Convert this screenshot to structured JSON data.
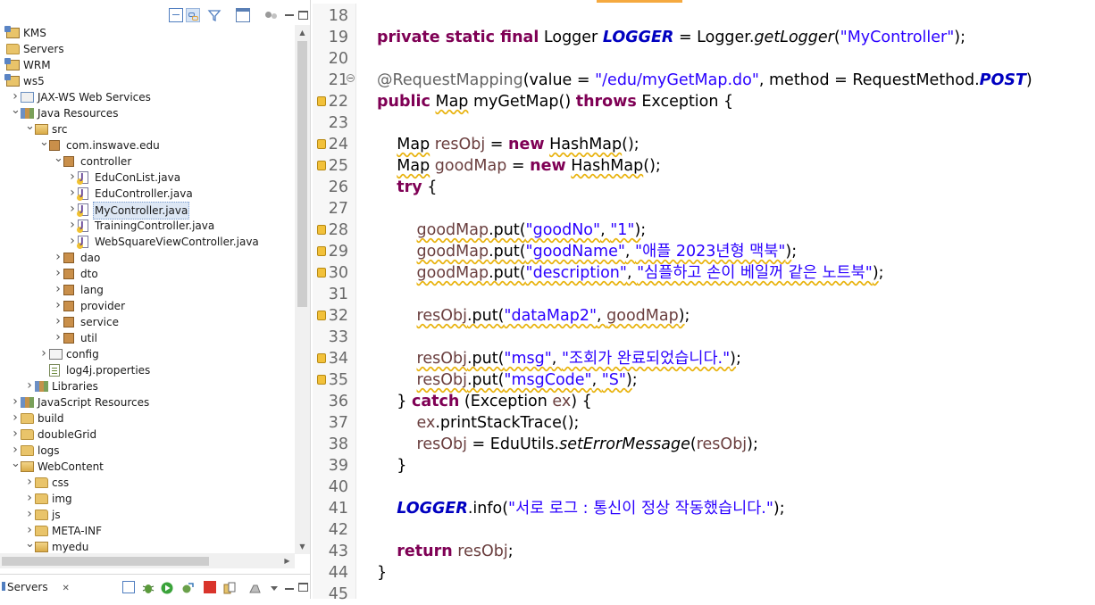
{
  "explorer": {
    "tree": [
      {
        "label": "KMS",
        "icon": "project-icon",
        "depth": 0,
        "twisty": ""
      },
      {
        "label": "Servers",
        "icon": "folder-icon",
        "depth": 0,
        "twisty": ""
      },
      {
        "label": "WRM",
        "icon": "project-icon",
        "depth": 0,
        "twisty": ""
      },
      {
        "label": "ws5",
        "icon": "project-icon",
        "depth": 0,
        "twisty": ""
      },
      {
        "label": "JAX-WS Web Services",
        "icon": "webservice-icon",
        "depth": 1,
        "twisty": "collapsed"
      },
      {
        "label": "Java Resources",
        "icon": "java-resources-icon",
        "depth": 1,
        "twisty": "expanded"
      },
      {
        "label": "src",
        "icon": "source-folder-icon",
        "depth": 2,
        "twisty": "expanded"
      },
      {
        "label": "com.inswave.edu",
        "icon": "package-icon",
        "depth": 3,
        "twisty": "expanded"
      },
      {
        "label": "controller",
        "icon": "package-icon",
        "depth": 4,
        "twisty": "expanded"
      },
      {
        "label": "EduConList.java",
        "icon": "java-file-icon",
        "depth": 5,
        "twisty": "collapsed"
      },
      {
        "label": "EduController.java",
        "icon": "java-file-icon",
        "depth": 5,
        "twisty": "collapsed"
      },
      {
        "label": "MyController.java",
        "icon": "java-file-icon",
        "depth": 5,
        "twisty": "collapsed",
        "selected": true
      },
      {
        "label": "TrainingController.java",
        "icon": "java-file-icon",
        "depth": 5,
        "twisty": "collapsed"
      },
      {
        "label": "WebSquareViewController.java",
        "icon": "java-file-icon",
        "depth": 5,
        "twisty": "collapsed"
      },
      {
        "label": "dao",
        "icon": "package-icon",
        "depth": 4,
        "twisty": "collapsed"
      },
      {
        "label": "dto",
        "icon": "package-icon",
        "depth": 4,
        "twisty": "collapsed"
      },
      {
        "label": "lang",
        "icon": "package-icon",
        "depth": 4,
        "twisty": "collapsed"
      },
      {
        "label": "provider",
        "icon": "package-icon",
        "depth": 4,
        "twisty": "collapsed"
      },
      {
        "label": "service",
        "icon": "package-icon",
        "depth": 4,
        "twisty": "collapsed"
      },
      {
        "label": "util",
        "icon": "package-icon",
        "depth": 4,
        "twisty": "collapsed"
      },
      {
        "label": "config",
        "icon": "config-folder-icon",
        "depth": 3,
        "twisty": "collapsed"
      },
      {
        "label": "log4j.properties",
        "icon": "properties-file-icon",
        "depth": 3,
        "twisty": ""
      },
      {
        "label": "Libraries",
        "icon": "libraries-icon",
        "depth": 2,
        "twisty": "collapsed"
      },
      {
        "label": "JavaScript Resources",
        "icon": "js-resources-icon",
        "depth": 1,
        "twisty": "collapsed"
      },
      {
        "label": "build",
        "icon": "folder-icon",
        "depth": 1,
        "twisty": "collapsed"
      },
      {
        "label": "doubleGrid",
        "icon": "folder-icon",
        "depth": 1,
        "twisty": "collapsed"
      },
      {
        "label": "logs",
        "icon": "folder-icon",
        "depth": 1,
        "twisty": "collapsed"
      },
      {
        "label": "WebContent",
        "icon": "open-folder-icon",
        "depth": 1,
        "twisty": "expanded"
      },
      {
        "label": "css",
        "icon": "folder-icon",
        "depth": 2,
        "twisty": "collapsed"
      },
      {
        "label": "img",
        "icon": "folder-icon",
        "depth": 2,
        "twisty": "collapsed"
      },
      {
        "label": "js",
        "icon": "folder-icon",
        "depth": 2,
        "twisty": "collapsed"
      },
      {
        "label": "META-INF",
        "icon": "folder-icon",
        "depth": 2,
        "twisty": "collapsed"
      },
      {
        "label": "myedu",
        "icon": "open-folder-icon",
        "depth": 2,
        "twisty": "expanded"
      }
    ]
  },
  "servers_tab": {
    "label": "Servers",
    "close": "✕"
  },
  "editor": {
    "lines": [
      {
        "n": "18",
        "mark": "",
        "html": ""
      },
      {
        "n": "19",
        "mark": "",
        "html": "<span class=\"kw\">private static final</span> Logger <span class=\"fld\">LOGGER</span> = Logger.<span class=\"smeth\">getLogger</span>(<span class=\"str\">\"MyController\"</span>);"
      },
      {
        "n": "20",
        "mark": "",
        "html": ""
      },
      {
        "n": "21",
        "mark": "fold",
        "html": "<span class=\"ann\">@RequestMapping</span>(value = <span class=\"str\">\"/edu/myGetMap.do\"</span>, method = RequestMethod.<span class=\"fld\">POST</span>)"
      },
      {
        "n": "22",
        "mark": "warn",
        "html": "<span class=\"kw\">public</span> <span class=\"wavy\">Map</span> myGetMap() <span class=\"kw\">throws</span> Exception {"
      },
      {
        "n": "23",
        "mark": "",
        "html": ""
      },
      {
        "n": "24",
        "mark": "warn",
        "html": "    <span class=\"wavy\">Map</span> <span class=\"var\">resObj</span> = <span class=\"kw\">new</span> <span class=\"wavy\">HashMap</span>();"
      },
      {
        "n": "25",
        "mark": "warn",
        "html": "    <span class=\"wavy\">Map</span> <span class=\"var\">goodMap</span> = <span class=\"kw\">new</span> <span class=\"wavy\">HashMap</span>();"
      },
      {
        "n": "26",
        "mark": "",
        "html": "    <span class=\"kw\">try</span> {"
      },
      {
        "n": "27",
        "mark": "",
        "html": ""
      },
      {
        "n": "28",
        "mark": "warn",
        "html": "        <span class=\"wavy\"><span class=\"var\">goodMap</span>.put(<span class=\"str\">\"goodNo\"</span>, <span class=\"str\">\"1\"</span>)</span>;"
      },
      {
        "n": "29",
        "mark": "warn",
        "html": "        <span class=\"wavy\"><span class=\"var\">goodMap</span>.put(<span class=\"str\">\"goodName\"</span>, <span class=\"str\">\"애플 2023년형 맥북\"</span>)</span>;"
      },
      {
        "n": "30",
        "mark": "warn",
        "html": "        <span class=\"wavy\"><span class=\"var\">goodMap</span>.put(<span class=\"str\">\"description\"</span>, <span class=\"str\">\"심플하고 손이 베일꺼 같은 노트북\"</span>)</span>;"
      },
      {
        "n": "31",
        "mark": "",
        "html": ""
      },
      {
        "n": "32",
        "mark": "warn",
        "html": "        <span class=\"wavy\"><span class=\"var\">resObj</span>.put(<span class=\"str\">\"dataMap2\"</span>, <span class=\"var\">goodMap</span>)</span>;"
      },
      {
        "n": "33",
        "mark": "",
        "html": ""
      },
      {
        "n": "34",
        "mark": "warn",
        "html": "        <span class=\"wavy\"><span class=\"var\">resObj</span>.put(<span class=\"str\">\"msg\"</span>, <span class=\"str\">\"조회가 완료되었습니다.\"</span>)</span>;"
      },
      {
        "n": "35",
        "mark": "warn",
        "html": "        <span class=\"wavy\"><span class=\"var\">resObj</span>.put(<span class=\"str\">\"msgCode\"</span>, <span class=\"str\">\"S\"</span>)</span>;"
      },
      {
        "n": "36",
        "mark": "",
        "html": "    } <span class=\"kw\">catch</span> (Exception <span class=\"var\">ex</span>) {"
      },
      {
        "n": "37",
        "mark": "",
        "html": "        <span class=\"var\">ex</span>.printStackTrace();"
      },
      {
        "n": "38",
        "mark": "",
        "html": "        <span class=\"var\">resObj</span> = EduUtils.<span class=\"smeth\">setErrorMessage</span>(<span class=\"var\">resObj</span>);"
      },
      {
        "n": "39",
        "mark": "",
        "html": "    }"
      },
      {
        "n": "40",
        "mark": "",
        "html": ""
      },
      {
        "n": "41",
        "mark": "",
        "html": "    <span class=\"fld\">LOGGER</span>.info(<span class=\"str\">\"서로 로그 : 통신이 정상 작동했습니다.\"</span>);"
      },
      {
        "n": "42",
        "mark": "",
        "html": ""
      },
      {
        "n": "43",
        "mark": "",
        "html": "    <span class=\"kw\">return</span> <span class=\"var\">resObj</span>;"
      },
      {
        "n": "44",
        "mark": "",
        "html": "}"
      },
      {
        "n": "45",
        "mark": "",
        "html": ""
      }
    ]
  },
  "colors": {
    "keyword": "#7f0055",
    "string": "#2a00ff",
    "static_field": "#0000c0",
    "local_var": "#6a3e3e",
    "warning": "#f2c13a",
    "active_tab": "#f5a93f",
    "selection": "#dde7f4"
  }
}
